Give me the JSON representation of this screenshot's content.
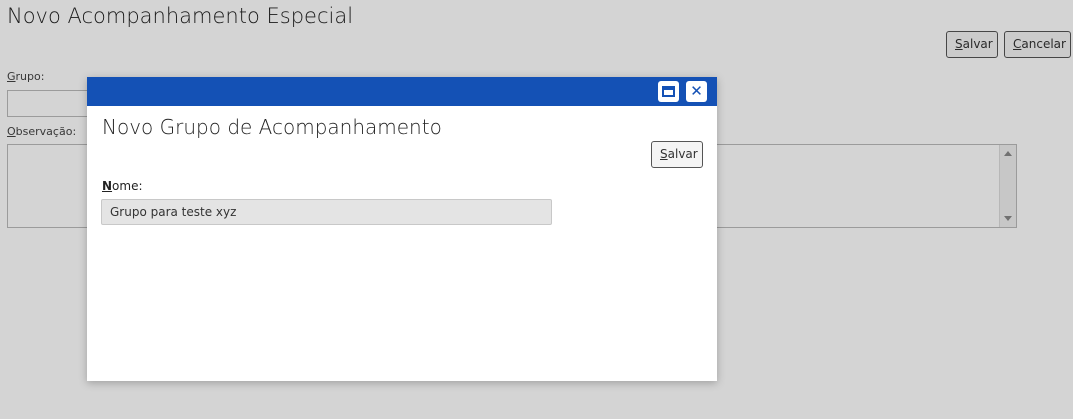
{
  "page": {
    "title": "Novo Acompanhamento Especial",
    "toolbar": {
      "save_access": "S",
      "save_rest": "alvar",
      "cancel_access": "C",
      "cancel_rest": "ancelar"
    },
    "form": {
      "grupo_label_access": "G",
      "grupo_label_rest": "rupo:",
      "obs_label_access": "O",
      "obs_label_rest": "bservação:"
    }
  },
  "modal": {
    "title": "Novo Grupo de Acompanhamento",
    "save_access": "S",
    "save_rest": "alvar",
    "nome_label_access": "N",
    "nome_label_rest": "ome:",
    "nome_value": "Grupo para teste xyz",
    "header_color": "#1451b5",
    "header_icons": [
      "maximize-icon",
      "close-icon"
    ]
  }
}
